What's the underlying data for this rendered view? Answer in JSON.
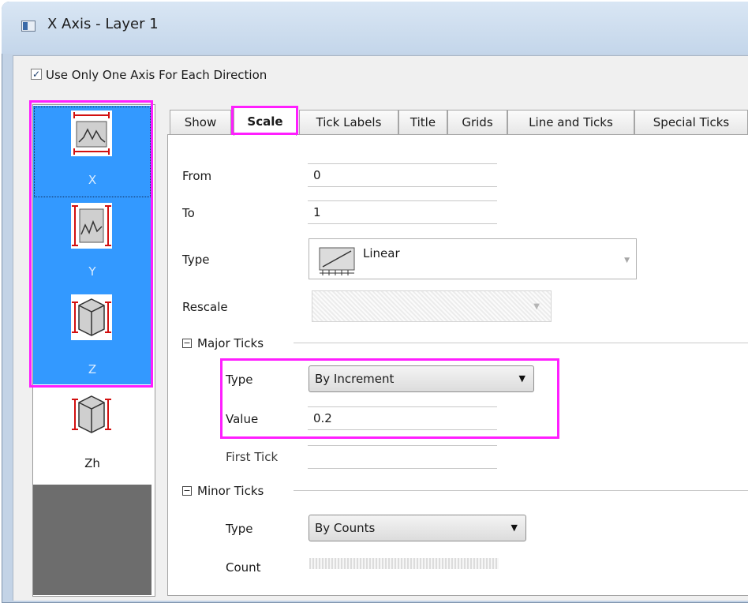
{
  "window": {
    "title": "X Axis - Layer 1"
  },
  "use_one_axis": {
    "label": "Use Only One Axis For Each Direction",
    "checked": true
  },
  "axis_list": [
    {
      "label": "X",
      "icon": "x-axis-icon",
      "selected": true
    },
    {
      "label": "Y",
      "icon": "y-axis-icon",
      "selected": true
    },
    {
      "label": "Z",
      "icon": "z-axis-icon",
      "selected": true
    },
    {
      "label": "Zh",
      "icon": "zh-axis-icon",
      "selected": false
    }
  ],
  "tabs": [
    {
      "label": "Show",
      "active": false
    },
    {
      "label": "Scale",
      "active": true
    },
    {
      "label": "Tick Labels",
      "active": false
    },
    {
      "label": "Title",
      "active": false
    },
    {
      "label": "Grids",
      "active": false
    },
    {
      "label": "Line and Ticks",
      "active": false
    },
    {
      "label": "Special Ticks",
      "active": false
    }
  ],
  "scale": {
    "from_label": "From",
    "from_value": "0",
    "to_label": "To",
    "to_value": "1",
    "type_label": "Type",
    "type_value": "Linear",
    "rescale_label": "Rescale"
  },
  "major_ticks": {
    "group_label": "Major Ticks",
    "type_label": "Type",
    "type_value": "By Increment",
    "value_label": "Value",
    "value_value": "0.2",
    "first_tick_label": "First Tick"
  },
  "minor_ticks": {
    "group_label": "Minor Ticks",
    "type_label": "Type",
    "type_value": "By Counts",
    "count_label": "Count"
  },
  "colors": {
    "selection": "#3399ff",
    "highlight": "#ff1eff"
  }
}
